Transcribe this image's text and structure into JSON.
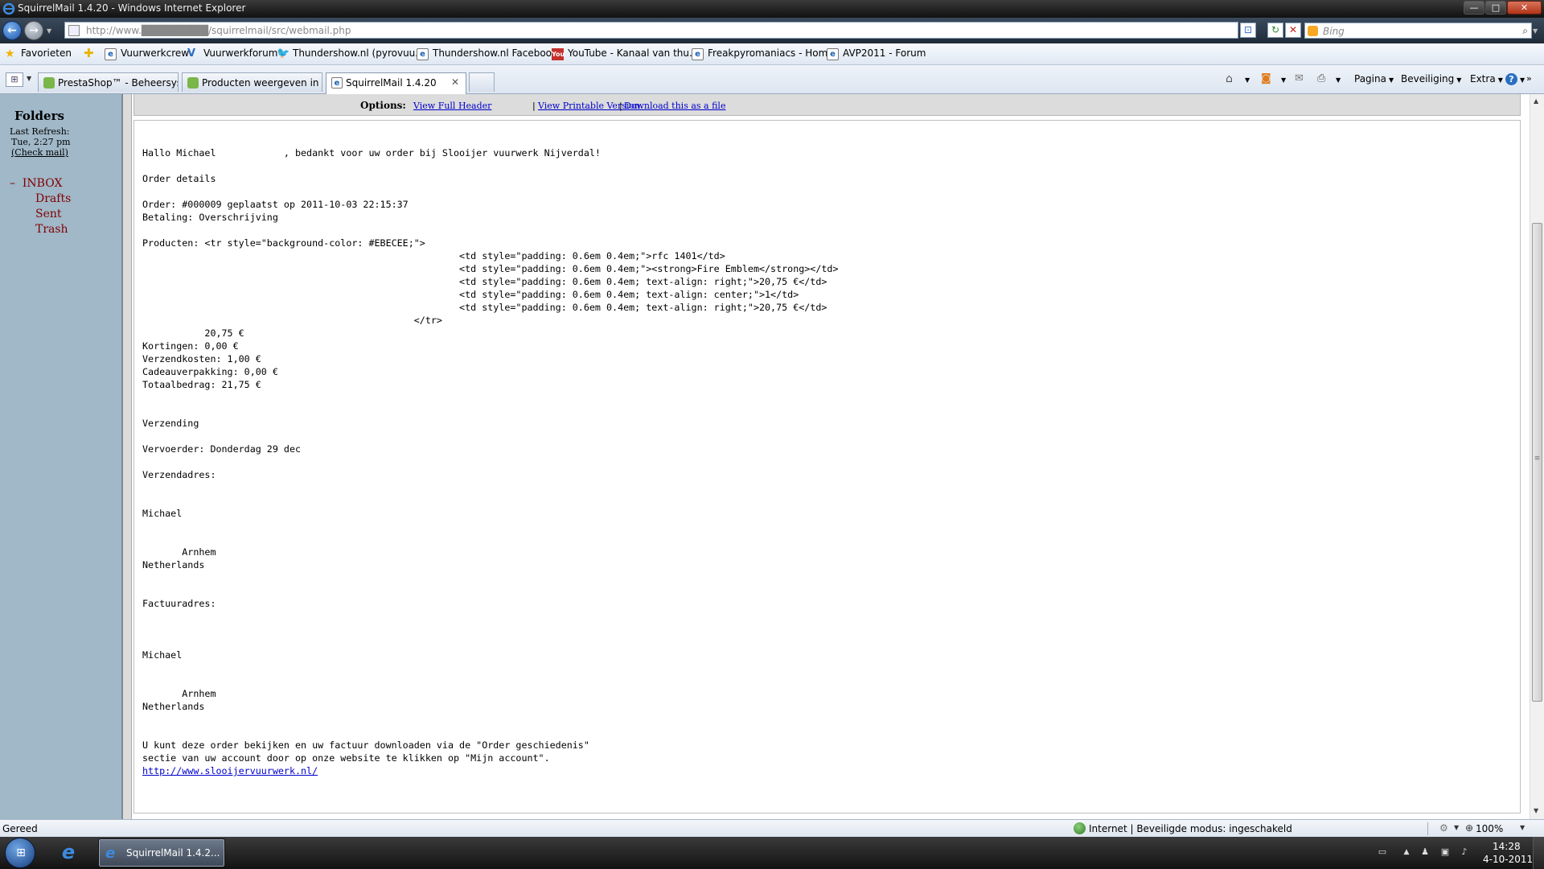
{
  "window": {
    "title": "SquirrelMail 1.4.20 - Windows Internet Explorer",
    "min_glyph": "—",
    "max_glyph": "□",
    "close_glyph": "✕"
  },
  "addressbar": {
    "back_glyph": "←",
    "forward_glyph": "→",
    "url": "http://www.█████████/squirrelmail/src/webmail.php",
    "search_placeholder": "Bing",
    "search_icon": "magnifier-icon",
    "stop_glyph": "✕",
    "refresh_glyph": "↻",
    "compat_glyph": "⊡"
  },
  "favorites": {
    "label": "Favorieten",
    "items": [
      {
        "label": "Vuurwerkcrew",
        "icon": "ie-page-icon"
      },
      {
        "label": "Vuurwerkforum",
        "icon": "v-logo-icon"
      },
      {
        "label": "Thundershow.nl (pyrovuu...",
        "icon": "twitter-bird-icon"
      },
      {
        "label": "Thundershow.nl Facebook",
        "icon": "ie-page-icon"
      },
      {
        "label": "YouTube - Kanaal van thu...",
        "icon": "youtube-icon"
      },
      {
        "label": "Freakpyromaniacs - Home",
        "icon": "ie-page-icon"
      },
      {
        "label": "AVP2011 - Forum",
        "icon": "ie-page-icon"
      }
    ]
  },
  "tabs": [
    {
      "label": "PrestaShop™ - Beheersyste...",
      "icon": "prestashop-icon"
    },
    {
      "label": "Producten weergeven in kl...",
      "icon": "prestashop-icon"
    },
    {
      "label": "SquirrelMail 1.4.20",
      "icon": "ie-page-icon",
      "active": true
    }
  ],
  "tab_close_glyph": "✕",
  "commandbar": {
    "pagina": "Pagina",
    "beveiliging": "Beveiliging",
    "extra": "Extra",
    "help_glyph": "?"
  },
  "folders": {
    "title": "Folders",
    "last_refresh_label": "Last Refresh:",
    "last_refresh_time": "Tue, 2:27 pm",
    "check_mail": "(Check mail)",
    "inbox_toggle": "–",
    "inbox": "INBOX",
    "items": [
      "Drafts",
      "Sent",
      "Trash"
    ]
  },
  "options": {
    "label": "Options:",
    "view_full_header": "View Full Header",
    "view_printable": "View Printable Version",
    "download": "Download this as a file",
    "separator": "|"
  },
  "message": {
    "body": "Hallo Michael            , bedankt voor uw order bij Slooijer vuurwerk Nijverdal!\n\nOrder details\n\nOrder: #000009 geplaatst op 2011-10-03 22:15:37\nBetaling: Overschrijving\n\nProducten: <tr style=\"background-color: #EBECEE;\">\n                                                        <td style=\"padding: 0.6em 0.4em;\">rfc 1401</td>\n                                                        <td style=\"padding: 0.6em 0.4em;\"><strong>Fire Emblem</strong></td>\n                                                        <td style=\"padding: 0.6em 0.4em; text-align: right;\">20,75 €</td>\n                                                        <td style=\"padding: 0.6em 0.4em; text-align: center;\">1</td>\n                                                        <td style=\"padding: 0.6em 0.4em; text-align: right;\">20,75 €</td>\n                                                </tr>\n           20,75 €\nKortingen: 0,00 €\nVerzendkosten: 1,00 €\nCadeauverpakking: 0,00 €\nTotaalbedrag: 21,75 €\n\n\nVerzending\n\nVervoerder: Donderdag 29 dec\n\nVerzendadres:\n\n\nMichael\n\n\n       Arnhem\nNetherlands\n\n\nFactuuradres:\n\n\n\nMichael\n\n\n       Arnhem\nNetherlands\n\n\nU kunt deze order bekijken en uw factuur downloaden via de \"Order geschiedenis\"\nsectie van uw account door op onze website te klikken op \"Mijn account\".\n",
    "link": "http://www.slooijervuurwerk.nl/"
  },
  "statusbar": {
    "status": "Gereed",
    "zone": "Internet | Beveiligde modus: ingeschakeld",
    "zoom": "100%"
  },
  "taskbar": {
    "task_label": "SquirrelMail 1.4.2...",
    "clock_time": "14:28",
    "clock_date": "4-10-2011"
  }
}
